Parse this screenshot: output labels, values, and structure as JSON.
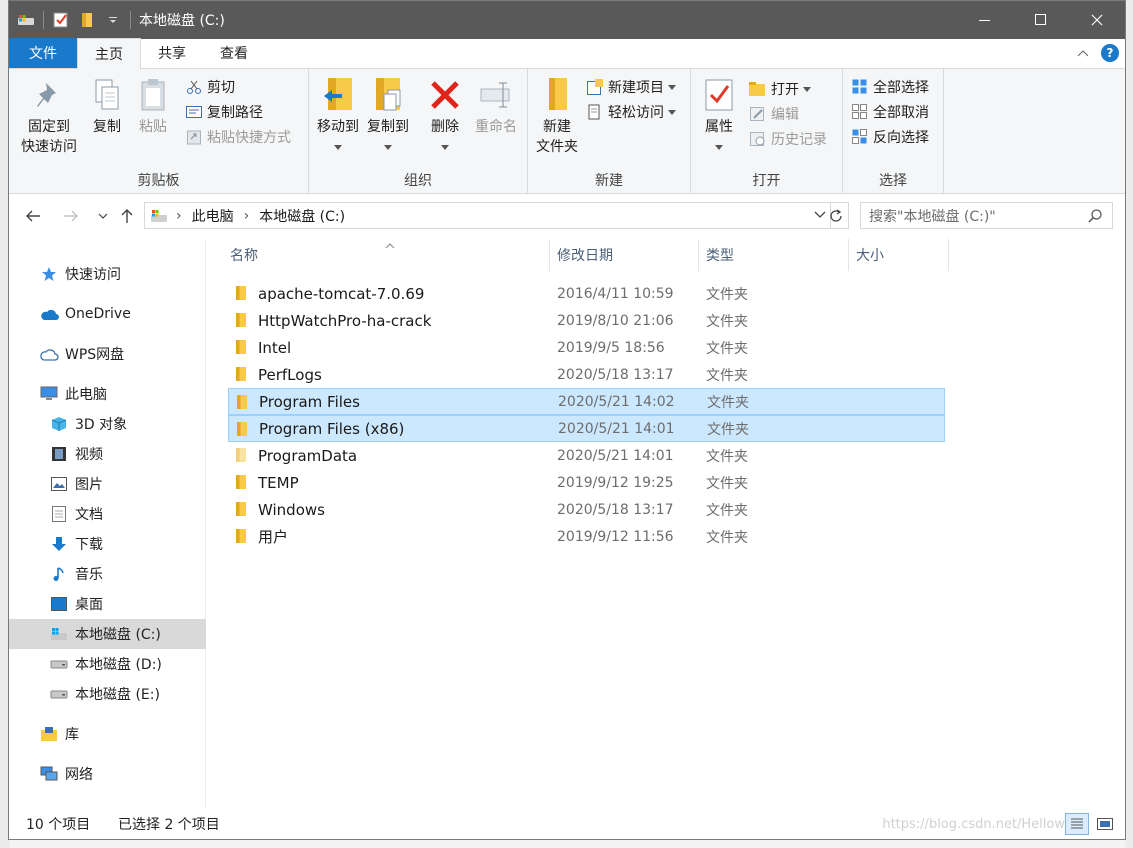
{
  "window": {
    "title": "本地磁盘 (C:)"
  },
  "tabs": [
    "文件",
    "主页",
    "共享",
    "查看"
  ],
  "ribbon": {
    "clipboard": {
      "label": "剪贴板",
      "pin": "固定到\n快速访问",
      "copy": "复制",
      "paste": "粘贴",
      "cut": "剪切",
      "copy_path": "复制路径",
      "paste_shortcut": "粘贴快捷方式"
    },
    "organize": {
      "label": "组织",
      "move_to": "移动到",
      "copy_to": "复制到",
      "delete": "删除",
      "rename": "重命名"
    },
    "new": {
      "label": "新建",
      "new_folder": "新建\n文件夹",
      "new_item": "新建项目",
      "easy_access": "轻松访问"
    },
    "open": {
      "label": "打开",
      "properties": "属性",
      "open": "打开",
      "edit": "编辑",
      "history": "历史记录"
    },
    "select": {
      "label": "选择",
      "select_all": "全部选择",
      "select_none": "全部取消",
      "invert": "反向选择"
    }
  },
  "address": {
    "crumbs": [
      "此电脑",
      "本地磁盘 (C:)"
    ],
    "search_placeholder": "搜索\"本地磁盘 (C:)\""
  },
  "nav": {
    "quick_access": "快速访问",
    "onedrive": "OneDrive",
    "wps": "WPS网盘",
    "this_pc": "此电脑",
    "objects3d": "3D 对象",
    "videos": "视频",
    "pictures": "图片",
    "documents": "文档",
    "downloads": "下载",
    "music": "音乐",
    "desktop": "桌面",
    "drive_c": "本地磁盘 (C:)",
    "drive_d": "本地磁盘 (D:)",
    "drive_e": "本地磁盘 (E:)",
    "libraries": "库",
    "network": "网络"
  },
  "columns": {
    "name": "名称",
    "date": "修改日期",
    "type": "类型",
    "size": "大小"
  },
  "files": [
    {
      "name": "apache-tomcat-7.0.69",
      "date": "2016/4/11 10:59",
      "type": "文件夹"
    },
    {
      "name": "HttpWatchPro-ha-crack",
      "date": "2019/8/10 21:06",
      "type": "文件夹"
    },
    {
      "name": "Intel",
      "date": "2019/9/5 18:56",
      "type": "文件夹"
    },
    {
      "name": "PerfLogs",
      "date": "2020/5/18 13:17",
      "type": "文件夹"
    },
    {
      "name": "Program Files",
      "date": "2020/5/21 14:02",
      "type": "文件夹"
    },
    {
      "name": "Program Files (x86)",
      "date": "2020/5/21 14:01",
      "type": "文件夹"
    },
    {
      "name": "ProgramData",
      "date": "2020/5/21 14:01",
      "type": "文件夹"
    },
    {
      "name": "TEMP",
      "date": "2019/9/12 19:25",
      "type": "文件夹"
    },
    {
      "name": "Windows",
      "date": "2020/5/18 13:17",
      "type": "文件夹"
    },
    {
      "name": "用户",
      "date": "2019/9/12 11:56",
      "type": "文件夹"
    }
  ],
  "status": {
    "count": "10 个项目",
    "selected": "已选择 2 个项目",
    "watermark": "https://blog.csdn.net/Hellow"
  },
  "colors": {
    "accent": "#1979ca",
    "selection": "#cce8ff",
    "folder": "#f8c94a"
  }
}
